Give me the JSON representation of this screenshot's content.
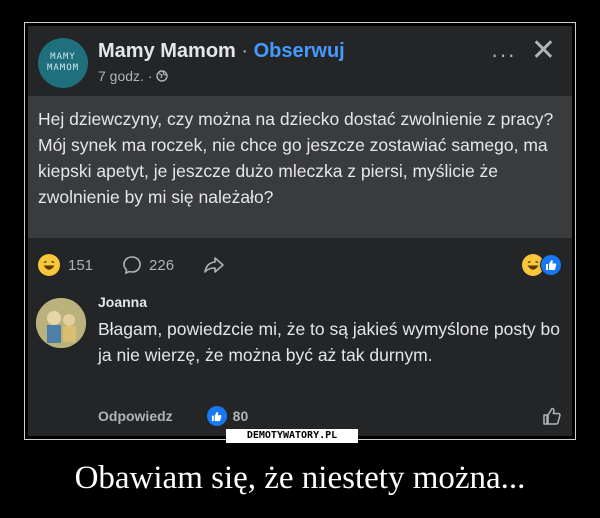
{
  "post": {
    "page_name": "Mamy Mamom",
    "separator": " · ",
    "follow_label": "Obserwuj",
    "time": "7 godz. ·",
    "avatar_lines": [
      "MAMY",
      "MAMOM"
    ],
    "more_icon": "···",
    "close_icon": "✕",
    "text": "Hej dziewczyny, czy można na dziecko dostać zwolnienie z pracy? Mój synek ma roczek, nie chce go jeszcze zostawiać samego, ma kiepski apetyt, je jeszcze dużo mleczka z piersi, myślicie że zwolnienie by mi się należało?"
  },
  "reactions": {
    "reaction_count": "151",
    "comment_count": "226"
  },
  "comment": {
    "author": "Joanna",
    "text": "Błagam, powiedzcie mi, że to są jakieś wymyślone posty bo ja nie wierzę, że można być aż tak durnym.",
    "reply_label": "Odpowiedz",
    "like_count": "80"
  },
  "watermark": "DEMOTYWATORY.PL",
  "caption": "Obawiam się, że niestety można...",
  "colors": {
    "background": "#000000",
    "card": "#242526",
    "highlight": "#3a3b3c",
    "accent": "#4599ff",
    "like": "#1877f2"
  }
}
